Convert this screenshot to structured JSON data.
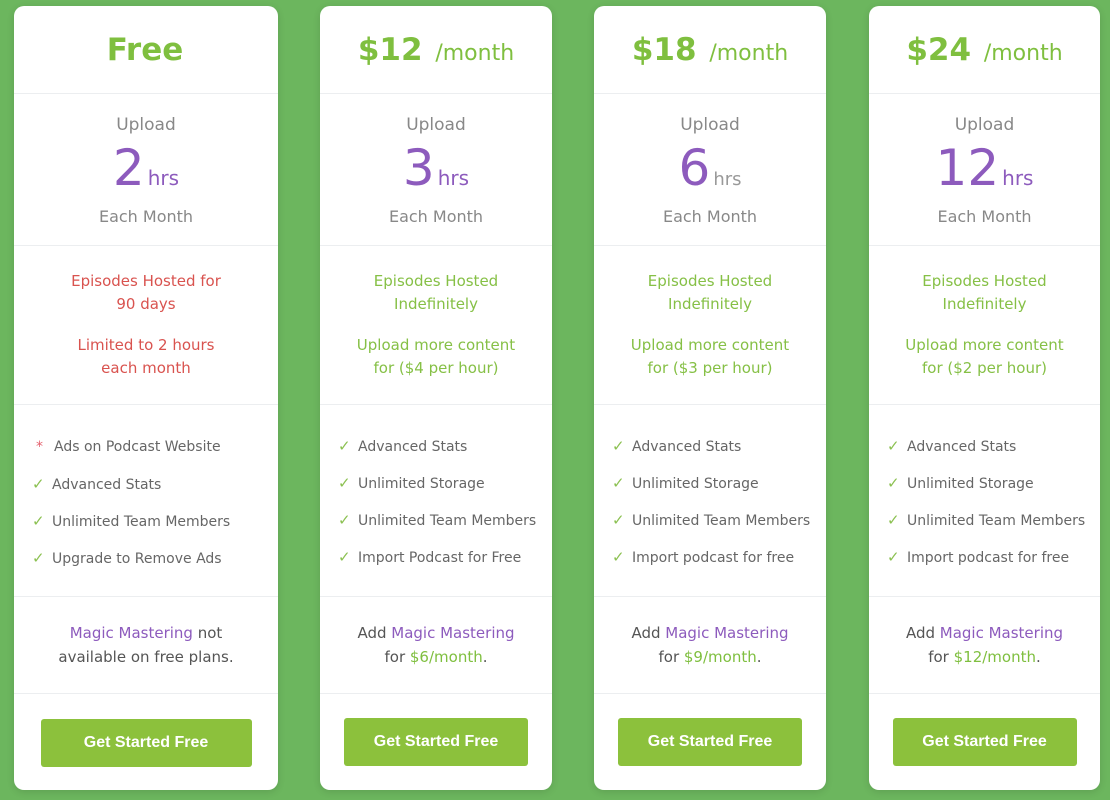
{
  "plans": [
    {
      "price": "Free",
      "per": "",
      "upload_label": "Upload",
      "hours": "2",
      "hours_unit": "hrs",
      "each_month": "Each Month",
      "hosting_line1": "Episodes Hosted for 90 days",
      "hosting_line2": "Limited to 2 hours each month",
      "features": [
        {
          "icon": "asterisk-icon",
          "text": "Ads on Podcast Website"
        },
        {
          "icon": "check-icon",
          "text": "Advanced Stats"
        },
        {
          "icon": "check-icon",
          "text": "Unlimited Team Members"
        },
        {
          "icon": "check-icon",
          "text": "Upgrade to Remove Ads"
        }
      ],
      "mm_pre": "",
      "mm_name": "Magic Mastering",
      "mm_post": " not available on free plans.",
      "mm_for": "",
      "mm_price": "",
      "mm_end": "",
      "button_label": "Get Started Free"
    },
    {
      "price": "$12",
      "per": "/month",
      "upload_label": "Upload",
      "hours": "3",
      "hours_unit": "hrs",
      "each_month": "Each Month",
      "hosting_line1": "Episodes Hosted Indefinitely",
      "hosting_line2": "Upload more content for ($4 per hour)",
      "features": [
        {
          "icon": "check-icon",
          "text": "Advanced Stats"
        },
        {
          "icon": "check-icon",
          "text": "Unlimited Storage"
        },
        {
          "icon": "check-icon",
          "text": "Unlimited Team Members"
        },
        {
          "icon": "check-icon",
          "text": "Import Podcast for Free"
        }
      ],
      "mm_pre": "Add ",
      "mm_name": "Magic Mastering",
      "mm_post": "",
      "mm_for": "for ",
      "mm_price": "$6/month",
      "mm_end": ".",
      "button_label": "Get Started Free"
    },
    {
      "price": "$18",
      "per": "/month",
      "upload_label": "Upload",
      "hours": "6",
      "hours_unit": "hrs",
      "each_month": "Each Month",
      "hosting_line1": "Episodes Hosted Indefinitely",
      "hosting_line2": "Upload more content for ($3 per hour)",
      "features": [
        {
          "icon": "check-icon",
          "text": "Advanced Stats"
        },
        {
          "icon": "check-icon",
          "text": "Unlimited Storage"
        },
        {
          "icon": "check-icon",
          "text": "Unlimited Team Members"
        },
        {
          "icon": "check-icon",
          "text": "Import podcast for free"
        }
      ],
      "mm_pre": "Add ",
      "mm_name": "Magic Mastering",
      "mm_post": "",
      "mm_for": "for ",
      "mm_price": "$9/month",
      "mm_end": ".",
      "button_label": "Get Started Free"
    },
    {
      "price": "$24",
      "per": "/month",
      "upload_label": "Upload",
      "hours": "12",
      "hours_unit": "hrs",
      "each_month": "Each Month",
      "hosting_line1": "Episodes Hosted Indefinitely",
      "hosting_line2": "Upload more content for ($2 per hour)",
      "features": [
        {
          "icon": "check-icon",
          "text": "Advanced Stats"
        },
        {
          "icon": "check-icon",
          "text": "Unlimited Storage"
        },
        {
          "icon": "check-icon",
          "text": "Unlimited Team Members"
        },
        {
          "icon": "check-icon",
          "text": "Import podcast for free"
        }
      ],
      "mm_pre": "Add ",
      "mm_name": "Magic Mastering",
      "mm_post": "",
      "mm_for": "for ",
      "mm_price": "$12/month",
      "mm_end": ".",
      "button_label": "Get Started Free"
    }
  ],
  "colors": {
    "background": "#6cb65e",
    "price_green": "#7fbf3f",
    "hours_purple": "#8d5bbd",
    "limit_red": "#d9534f",
    "button_green": "#8cc13c"
  }
}
